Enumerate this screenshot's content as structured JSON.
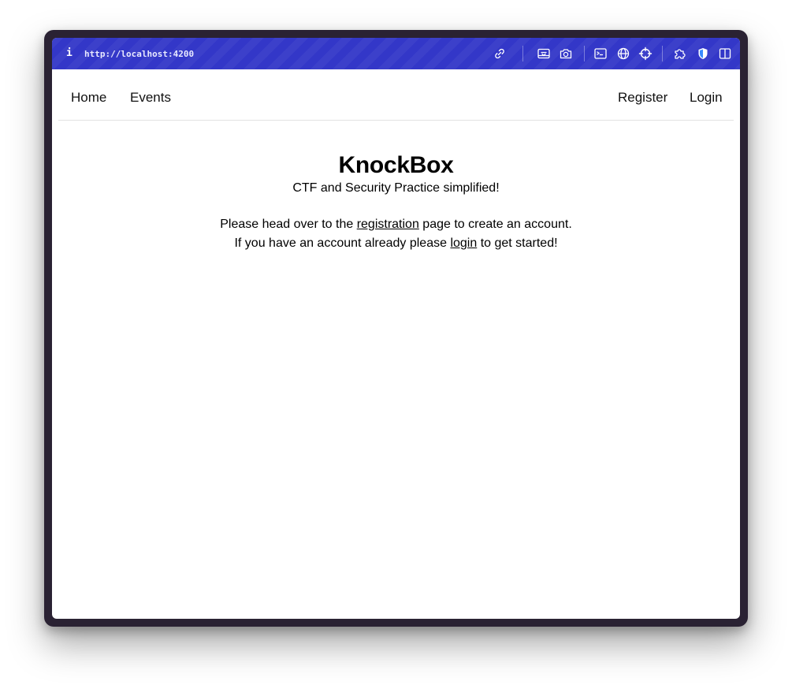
{
  "browser": {
    "info_glyph": "i",
    "url": "http://localhost:4200",
    "toolbar_icons": [
      "link-icon",
      "screenshot-icon",
      "camera-icon",
      "terminal-icon",
      "globe-icon",
      "crosshair-icon",
      "extensions-icon",
      "shield-icon",
      "sidebar-icon"
    ]
  },
  "nav": {
    "left": [
      "Home",
      "Events"
    ],
    "right": [
      "Register",
      "Login"
    ]
  },
  "hero": {
    "title": "KnockBox",
    "subtitle": "CTF and Security Practice simplified!",
    "line1_before": "Please head over to the ",
    "line1_link": "registration",
    "line1_after": " page to create an account.",
    "line2_before": "If you have an account already please ",
    "line2_link": "login",
    "line2_after": " to get started!"
  },
  "colors": {
    "toolbar": "#3337c8",
    "frame": "#2a2233",
    "text": "#000000"
  }
}
